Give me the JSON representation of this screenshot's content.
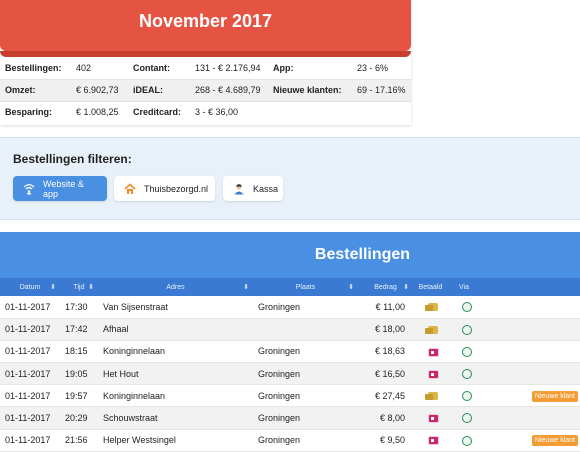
{
  "stats": {
    "title": "November 2017",
    "rows": [
      [
        {
          "label": "Bestellingen:",
          "value": "402"
        },
        {
          "label": "Contant:",
          "value": "131 - € 2.176,94"
        },
        {
          "label": "App:",
          "value": "23 - 6%"
        }
      ],
      [
        {
          "label": "Omzet:",
          "value": "€ 6.902,73"
        },
        {
          "label": "iDEAL:",
          "value": "268 - € 4.689,79"
        },
        {
          "label": "Nieuwe klanten:",
          "value": "69 - 17.16%"
        }
      ],
      [
        {
          "label": "Besparing:",
          "value": "€ 1.008,25"
        },
        {
          "label": "Creditcard:",
          "value": "3 - € 36,00"
        },
        {
          "label": "",
          "value": ""
        }
      ]
    ]
  },
  "filters": {
    "title": "Bestellingen filteren:",
    "buttons": [
      {
        "label": "Website & app",
        "icon": "wifi-icon",
        "active": true
      },
      {
        "label": "Thuisbezorgd.nl",
        "icon": "house-icon",
        "active": false
      },
      {
        "label": "Kassa",
        "icon": "person-icon",
        "active": false
      }
    ]
  },
  "orders": {
    "title": "Bestellingen",
    "columns": [
      "Datum",
      "Tijd",
      "Adres",
      "Plaats",
      "Bedrag",
      "Betaald",
      "Via"
    ],
    "badge_label": "Nieuwe klant",
    "rows": [
      {
        "date": "01-11-2017",
        "time": "17:30",
        "address": "Van Sijsenstraat",
        "place": "Groningen",
        "amount": "€ 11,00",
        "paid": "cash",
        "via": "app-icon",
        "badge": false
      },
      {
        "date": "01-11-2017",
        "time": "17:42",
        "address": "Afhaal",
        "place": "",
        "amount": "€ 18,00",
        "paid": "cash",
        "via": "app-icon",
        "badge": false
      },
      {
        "date": "01-11-2017",
        "time": "18:15",
        "address": "Koninginnelaan",
        "place": "Groningen",
        "amount": "€ 18,63",
        "paid": "ideal",
        "via": "app-icon",
        "badge": false
      },
      {
        "date": "01-11-2017",
        "time": "19:05",
        "address": "Het Hout",
        "place": "Groningen",
        "amount": "€ 16,50",
        "paid": "ideal",
        "via": "app-icon",
        "badge": false
      },
      {
        "date": "01-11-2017",
        "time": "19:57",
        "address": "Koninginnelaan",
        "place": "Groningen",
        "amount": "€ 27,45",
        "paid": "cash",
        "via": "app-icon",
        "badge": true
      },
      {
        "date": "01-11-2017",
        "time": "20:29",
        "address": "Schouwstraat",
        "place": "Groningen",
        "amount": "€ 8,00",
        "paid": "ideal",
        "via": "app-icon",
        "badge": false
      },
      {
        "date": "01-11-2017",
        "time": "21:56",
        "address": "Helper Westsingel",
        "place": "Groningen",
        "amount": "€ 9,50",
        "paid": "ideal",
        "via": "app-icon",
        "badge": true
      }
    ]
  },
  "colors": {
    "header_red": "#e55442",
    "header_blue": "#4a90e2",
    "badge_orange": "#f39c33"
  }
}
